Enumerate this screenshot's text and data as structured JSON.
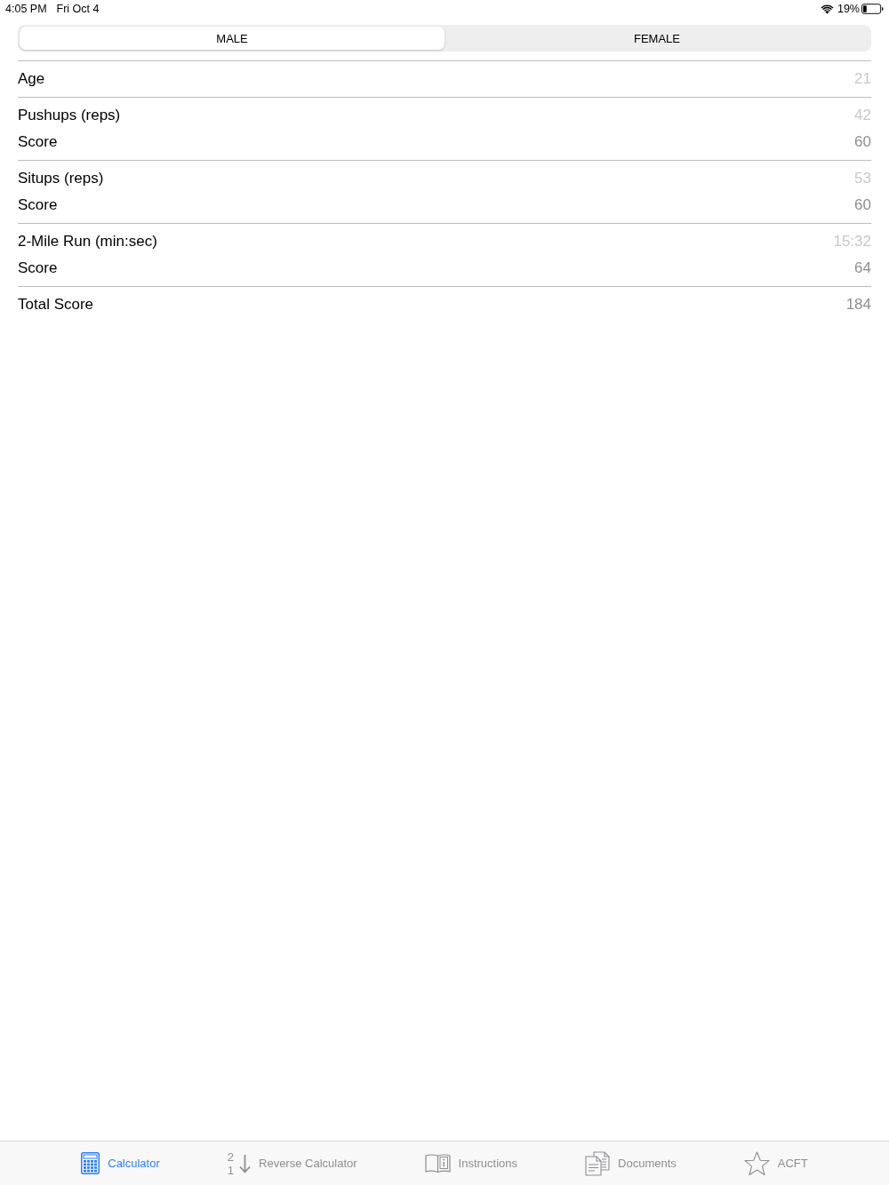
{
  "status_bar": {
    "time": "4:05 PM",
    "date": "Fri Oct 4",
    "battery": "19%"
  },
  "segments": [
    {
      "label": "MALE",
      "selected": true
    },
    {
      "label": "FEMALE",
      "selected": false
    }
  ],
  "groups": [
    {
      "rows": [
        {
          "kind": "input",
          "label": "Age",
          "placeholder": "21"
        }
      ]
    },
    {
      "rows": [
        {
          "kind": "input",
          "label": "Pushups (reps)",
          "placeholder": "42"
        },
        {
          "kind": "output",
          "label": "Score",
          "value": "60"
        }
      ]
    },
    {
      "rows": [
        {
          "kind": "input",
          "label": "Situps (reps)",
          "placeholder": "53"
        },
        {
          "kind": "output",
          "label": "Score",
          "value": "60"
        }
      ]
    },
    {
      "rows": [
        {
          "kind": "input",
          "label": "2-Mile Run (min:sec)",
          "placeholder": "15:32"
        },
        {
          "kind": "output",
          "label": "Score",
          "value": "64"
        }
      ]
    },
    {
      "rows": [
        {
          "kind": "output",
          "label": "Total Score",
          "value": "184"
        }
      ]
    }
  ],
  "tab_bar": [
    {
      "kind": "calculator",
      "label": "Calculator",
      "selected": true
    },
    {
      "kind": "reverse",
      "label": "Reverse Calculator",
      "selected": false,
      "icon_digits": [
        "2",
        "1"
      ]
    },
    {
      "kind": "book",
      "label": "Instructions",
      "selected": false
    },
    {
      "kind": "documents",
      "label": "Documents",
      "selected": false
    },
    {
      "kind": "star",
      "label": "ACFT",
      "selected": false
    }
  ]
}
